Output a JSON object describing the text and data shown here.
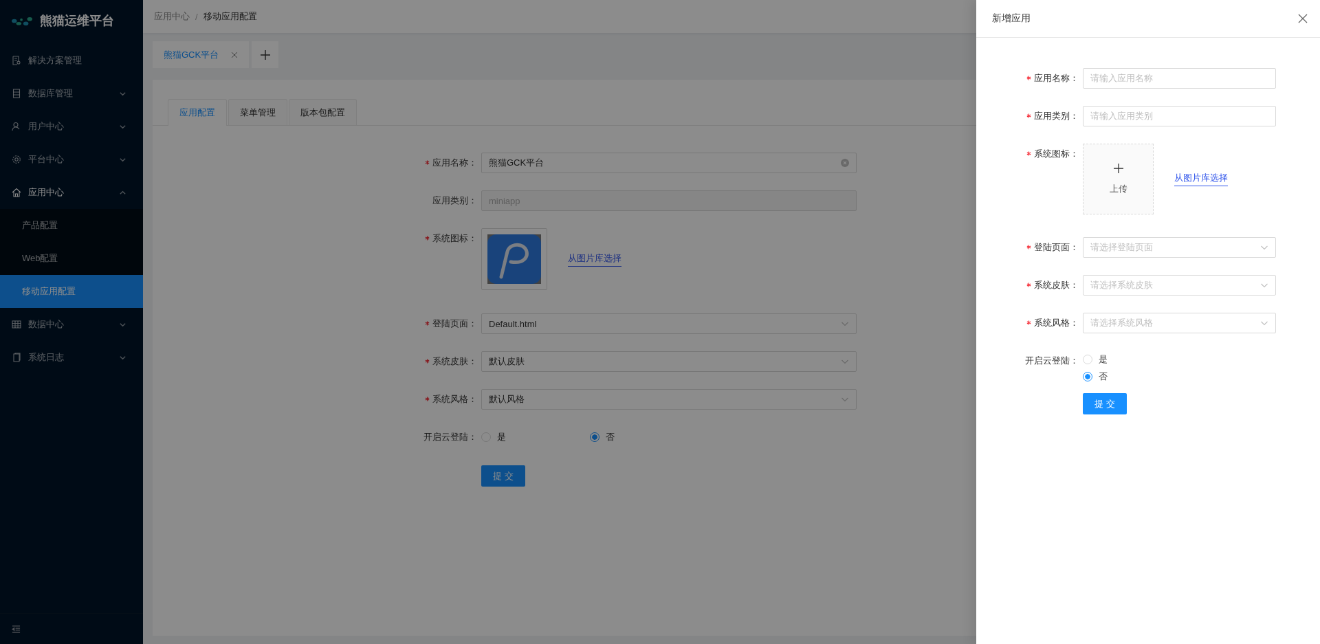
{
  "sidebar": {
    "logo": "熊猫运维平台",
    "items": [
      {
        "label": "解决方案管理",
        "kind": "link"
      },
      {
        "label": "数据库管理",
        "kind": "submenu",
        "expanded": false
      },
      {
        "label": "用户中心",
        "kind": "submenu",
        "expanded": false
      },
      {
        "label": "平台中心",
        "kind": "submenu",
        "expanded": false
      },
      {
        "label": "应用中心",
        "kind": "submenu",
        "expanded": true,
        "children": [
          {
            "label": "产品配置",
            "selected": false
          },
          {
            "label": "Web配置",
            "selected": false
          },
          {
            "label": "移动应用配置",
            "selected": true
          }
        ]
      },
      {
        "label": "数据中心",
        "kind": "submenu",
        "expanded": false
      },
      {
        "label": "系统日志",
        "kind": "submenu",
        "expanded": false
      }
    ]
  },
  "breadcrumb": {
    "items": [
      "应用中心",
      "移动应用配置"
    ],
    "separator": "/"
  },
  "page_tabs": [
    {
      "label": "熊猫GCK平台",
      "selected": true
    }
  ],
  "config_tabs": [
    {
      "label": "应用配置",
      "selected": true
    },
    {
      "label": "菜单管理",
      "selected": false
    },
    {
      "label": "版本包配置",
      "selected": false
    }
  ],
  "main_form": {
    "fields": [
      {
        "kind": "input",
        "label": "应用名称：",
        "required": true,
        "value": "熊猫GCK平台",
        "disabled": false
      },
      {
        "kind": "input",
        "label": "应用类别：",
        "required": false,
        "value": "miniapp",
        "disabled": true
      },
      {
        "kind": "upload",
        "label": "系统图标：",
        "required": true,
        "uploaded": true,
        "link": "从图片库选择"
      },
      {
        "kind": "select",
        "label": "登陆页面：",
        "required": true,
        "value": "Default.html"
      },
      {
        "kind": "select",
        "label": "系统皮肤：",
        "required": true,
        "value": "默认皮肤"
      },
      {
        "kind": "select",
        "label": "系统风格：",
        "required": true,
        "value": "默认风格"
      },
      {
        "kind": "radio",
        "label": "开启云登陆：",
        "required": false,
        "vertical": false,
        "options": [
          {
            "label": "是",
            "selected": false
          },
          {
            "label": "否",
            "selected": true
          }
        ]
      }
    ],
    "submit": "提 交"
  },
  "drawer": {
    "title": "新增应用",
    "fields": [
      {
        "kind": "input",
        "label": "应用名称：",
        "required": true,
        "placeholder": "请输入应用名称"
      },
      {
        "kind": "input",
        "label": "应用类别：",
        "required": true,
        "placeholder": "请输入应用类别"
      },
      {
        "kind": "upload",
        "label": "系统图标：",
        "required": true,
        "uploaded": false,
        "upload_label": "上传",
        "link": "从图片库选择"
      },
      {
        "kind": "select",
        "label": "登陆页面：",
        "required": true,
        "placeholder": "请选择登陆页面"
      },
      {
        "kind": "select",
        "label": "系统皮肤：",
        "required": true,
        "placeholder": "请选择系统皮肤"
      },
      {
        "kind": "select",
        "label": "系统风格：",
        "required": true,
        "placeholder": "请选择系统风格"
      },
      {
        "kind": "radio",
        "label": "开启云登陆：",
        "required": false,
        "vertical": true,
        "options": [
          {
            "label": "是",
            "selected": false
          },
          {
            "label": "否",
            "selected": true
          }
        ]
      }
    ],
    "submit": "提 交"
  }
}
